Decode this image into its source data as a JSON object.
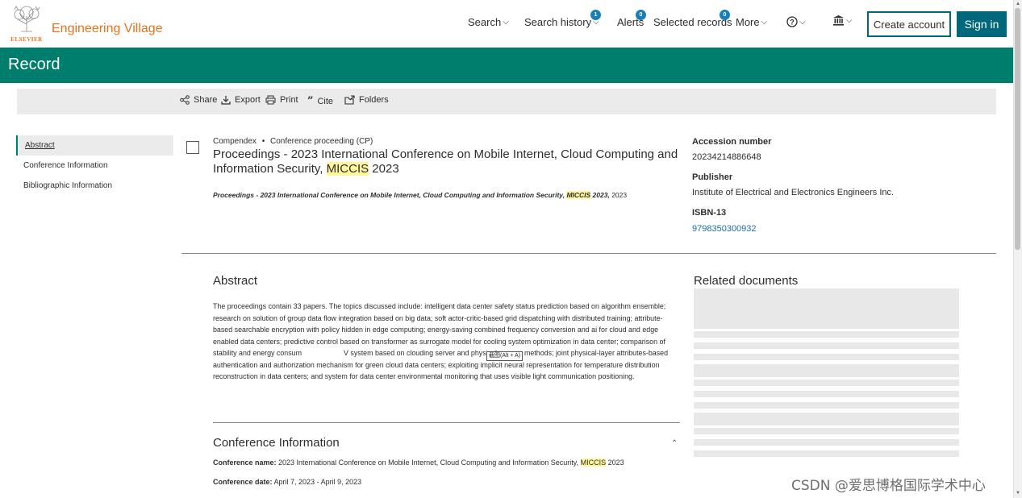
{
  "header": {
    "logo_text": "ELSEVIER",
    "brand": "Engineering Village",
    "nav": {
      "search": "Search",
      "search_history": "Search history",
      "search_history_badge": "1",
      "alerts": "Alerts",
      "alerts_badge": "0",
      "selected_records": "Selected records",
      "selected_records_badge": "0",
      "more": "More"
    },
    "create_account": "Create account",
    "sign_in": "Sign in"
  },
  "banner": {
    "title": "Record"
  },
  "toolbar": {
    "share": "Share",
    "export": "Export",
    "print": "Print",
    "cite": "Cite",
    "folders": "Folders"
  },
  "sidebar": {
    "items": [
      {
        "label": "Abstract"
      },
      {
        "label": "Conference Information"
      },
      {
        "label": "Bibliographic Information"
      }
    ]
  },
  "record": {
    "database": "Compendex",
    "separator": "•",
    "doc_type": "Conference proceeding (CP)",
    "title_part1": "Proceedings - 2023 International Conference on Mobile Internet, Cloud Computing and Information Security, ",
    "title_highlight": "MICCIS",
    "title_part2": " 2023",
    "source_part1": "Proceedings - 2023 International Conference on Mobile Internet, Cloud Computing and Information Security, ",
    "source_highlight": "MICCIS",
    "source_part2": " 2023,",
    "source_year": " 2023"
  },
  "details": {
    "accession_label": "Accession number",
    "accession_value": "20234214886648",
    "publisher_label": "Publisher",
    "publisher_value": "Institute of Electrical and Electronics Engineers Inc.",
    "isbn_label": "ISBN-13",
    "isbn_value": "9798350300932"
  },
  "abstract": {
    "heading": "Abstract",
    "text_before_tooltip": "The proceedings contain 33 papers. The topics discussed include: intelligent data center safety status prediction based on algorithm ensemble; research on solution of group data flow integration based on big data; soft actor-critic-based grid dispatching with distributed training; attribute-based searchable encryption with policy hidden in edge computing; energy-saving combined frequency conversion and ai for cloud and edge enabled data centers; predictive control based on transformer as surrogate model for cooling system optimization in data center; comparison of stability and energy consum",
    "text_after_tooltip": "V system based on clouding server and physical servers methods; joint physical-layer attributes-based authentication and authorization mechanism for green cloud data centers; exploiting implicit neural representation for temperature distribution reconstruction in data centers; and system for data center environmental monitoring that uses visible light communication positioning.",
    "tooltip": "截图(Alt + A)"
  },
  "related": {
    "heading": "Related documents"
  },
  "conference": {
    "heading": "Conference Information",
    "name_label": "Conference name:",
    "name_part1": " 2023 International Conference on Mobile Internet, Cloud Computing and Information Security, ",
    "name_highlight": "MICCIS",
    "name_part2": " 2023",
    "date_label": "Conference date:",
    "date_value": " April 7, 2023 - April 9, 2023"
  },
  "watermark": "CSDN @爱思博格国际学术中心",
  "colors": {
    "banner": "#007e6d",
    "brand_orange": "#e9711c",
    "button": "#00687a",
    "badge": "#1a7fb5",
    "highlight": "#fff59d",
    "link": "#1a6ea8"
  }
}
